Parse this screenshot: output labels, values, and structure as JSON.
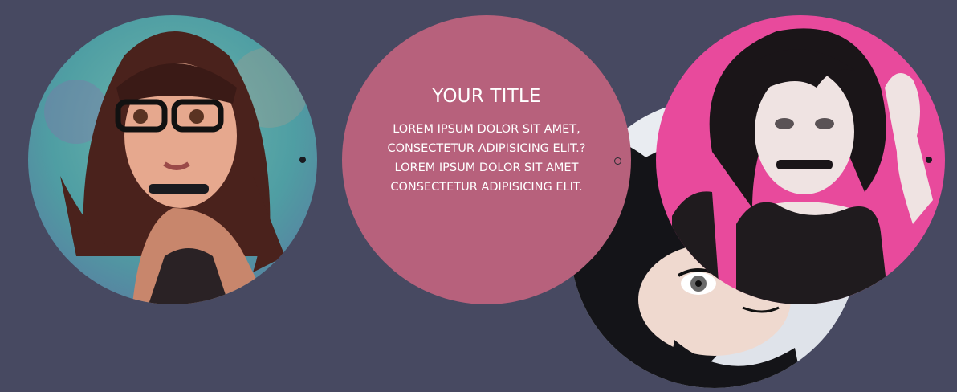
{
  "caption": {
    "title": "YOUR TITLE",
    "lines": [
      "LOREM IPSUM DOLOR SIT AMET,",
      "CONSECTETUR ADIPISICING ELIT.?",
      "LOREM IPSUM DOLOR SIT AMET",
      "CONSECTETUR ADIPISICING ELIT."
    ]
  },
  "colors": {
    "background": "#474961",
    "caption_circle": "#b7617c",
    "pink_backdrop": "#e84a9c",
    "teal_backdrop": "#4fa3a4",
    "dot": "#1a1a1f"
  },
  "images": [
    {
      "name": "portrait-glasses-girl",
      "subject": "girl-with-glasses"
    },
    {
      "name": "portrait-upside-down-girl",
      "subject": "upside-down-girl"
    },
    {
      "name": "portrait-pink-background-girl",
      "subject": "girl-on-pink"
    }
  ]
}
